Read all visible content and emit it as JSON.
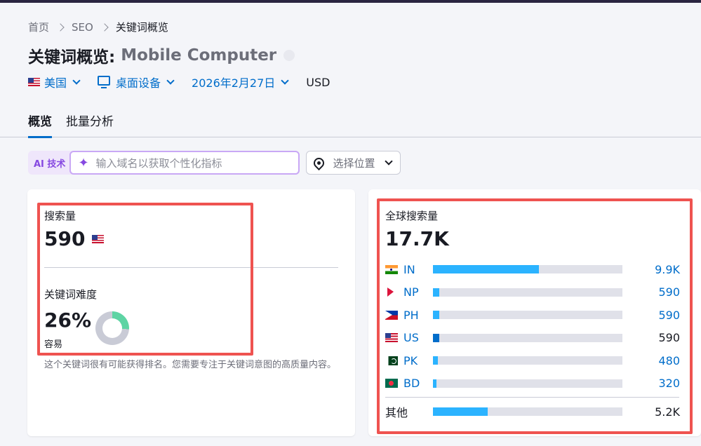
{
  "breadcrumb": [
    "首页",
    "SEO",
    "关键词概览"
  ],
  "title": {
    "prefix": "关键词概览:",
    "keyword": "Mobile Computer"
  },
  "filters": {
    "country": "美国",
    "device": "桌面设备",
    "date": "2026年2月27日",
    "currency": "USD"
  },
  "tabs": [
    "概览",
    "批量分析"
  ],
  "ai": {
    "label": "AI 技术",
    "placeholder": "输入域名以获取个性化指标"
  },
  "location": {
    "label": "选择位置"
  },
  "volume": {
    "label": "搜索量",
    "value": "590"
  },
  "difficulty": {
    "label": "关键词难度",
    "value": "26%",
    "level": "容易",
    "percent": 26,
    "description": "这个关键词很有可能获得排名。您需要专注于关键词意图的高质量内容。"
  },
  "global": {
    "label": "全球搜索量",
    "value": "17.7K",
    "countries": [
      {
        "code": "IN",
        "value": "9.9K",
        "fraction": 0.56,
        "flag": "india-flag-icon"
      },
      {
        "code": "NP",
        "value": "590",
        "fraction": 0.033,
        "flag": "nepal-flag-icon"
      },
      {
        "code": "PH",
        "value": "590",
        "fraction": 0.033,
        "flag": "philippines-flag-icon"
      },
      {
        "code": "US",
        "value": "590",
        "fraction": 0.033,
        "flag": "us-flag-icon"
      },
      {
        "code": "PK",
        "value": "480",
        "fraction": 0.027,
        "flag": "pakistan-flag-icon"
      },
      {
        "code": "BD",
        "value": "320",
        "fraction": 0.018,
        "flag": "bangladesh-flag-icon"
      }
    ],
    "other": {
      "label": "其他",
      "value": "5.2K",
      "fraction": 0.29
    }
  },
  "colors": {
    "accent": "#006dca",
    "bar": "#2bb3ff",
    "highlight": "#ef5350",
    "ai": "#8649e1"
  }
}
